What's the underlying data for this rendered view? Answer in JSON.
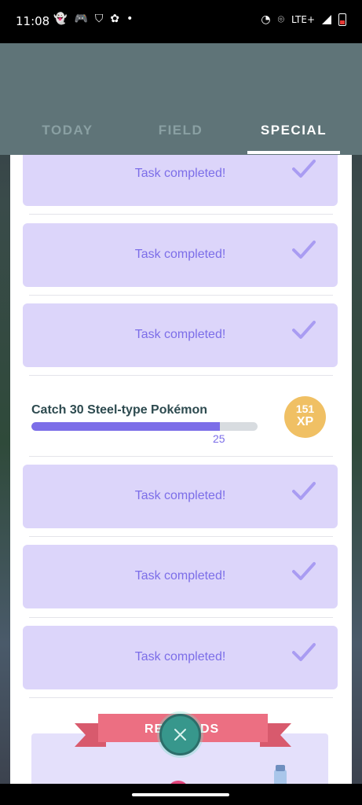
{
  "status_bar": {
    "time": "11:08",
    "network": "LTE+"
  },
  "tabs": [
    {
      "label": "TODAY",
      "active": false
    },
    {
      "label": "FIELD",
      "active": false
    },
    {
      "label": "SPECIAL",
      "active": true
    }
  ],
  "completed_label": "Task completed!",
  "active_task": {
    "title": "Catch 30 Steel-type Pokémon",
    "progress_value": "25",
    "progress_fraction": 0.833,
    "reward_amount": "151",
    "reward_unit": "XP"
  },
  "rewards": {
    "label_left": "RE",
    "label_right": "DS"
  },
  "colors": {
    "accent": "#7c6ee8",
    "card_bg": "#dcd5fa",
    "header_bg": "#5f7478",
    "xp_badge": "#f0c064",
    "ribbon": "#ec6f82",
    "close_button": "#37978c"
  }
}
